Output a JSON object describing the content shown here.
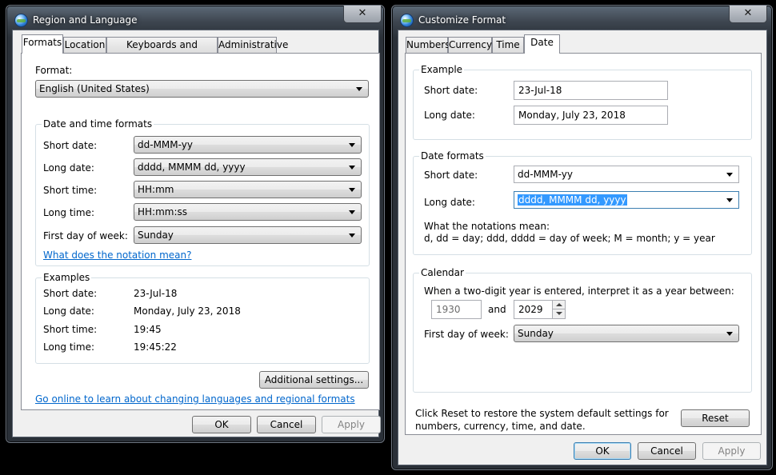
{
  "left_window": {
    "title": "Region and Language",
    "close_label": "✕",
    "tabs": [
      "Formats",
      "Location",
      "Keyboards and Languages",
      "Administrative"
    ],
    "format_label": "Format:",
    "format_value": "English (United States)",
    "datetime_group": {
      "title": "Date and time formats",
      "rows": [
        {
          "label": "Short date:",
          "value": "dd-MMM-yy"
        },
        {
          "label": "Long date:",
          "value": "dddd, MMMM dd, yyyy"
        },
        {
          "label": "Short time:",
          "value": "HH:mm"
        },
        {
          "label": "Long time:",
          "value": "HH:mm:ss"
        },
        {
          "label": "First day of week:",
          "value": "Sunday"
        }
      ],
      "notation_link": "What does the notation mean?"
    },
    "examples_group": {
      "title": "Examples",
      "rows": [
        {
          "label": "Short date:",
          "value": "23-Jul-18"
        },
        {
          "label": "Long date:",
          "value": "Monday, July 23, 2018"
        },
        {
          "label": "Short time:",
          "value": "19:45"
        },
        {
          "label": "Long time:",
          "value": "19:45:22"
        }
      ]
    },
    "additional_settings": "Additional settings...",
    "online_link": "Go online to learn about changing languages and regional formats",
    "buttons": {
      "ok": "OK",
      "cancel": "Cancel",
      "apply": "Apply"
    }
  },
  "right_window": {
    "title": "Customize Format",
    "close_label": "✕",
    "tabs": [
      "Numbers",
      "Currency",
      "Time",
      "Date"
    ],
    "example_group": {
      "title": "Example",
      "short_label": "Short date:",
      "short_value": "23-Jul-18",
      "long_label": "Long date:",
      "long_value": "Monday, July 23, 2018"
    },
    "formats_group": {
      "title": "Date formats",
      "short_label": "Short date:",
      "short_value": "dd-MMM-yy",
      "long_label": "Long date:",
      "long_value": "dddd, MMMM dd, yyyy",
      "notation_title": "What the notations mean:",
      "notation_text": "d, dd = day;  ddd, dddd = day of week;  M = month;  y = year"
    },
    "calendar_group": {
      "title": "Calendar",
      "two_digit_text": "When a two-digit year is entered, interpret it as a year between:",
      "year_from": "1930",
      "and_label": "and",
      "year_to": "2029",
      "first_day_label": "First day of week:",
      "first_day_value": "Sunday"
    },
    "reset_text_line1": "Click Reset to restore the system default settings for",
    "reset_text_line2": "numbers, currency, time, and date.",
    "reset_button": "Reset",
    "buttons": {
      "ok": "OK",
      "cancel": "Cancel",
      "apply": "Apply"
    }
  }
}
